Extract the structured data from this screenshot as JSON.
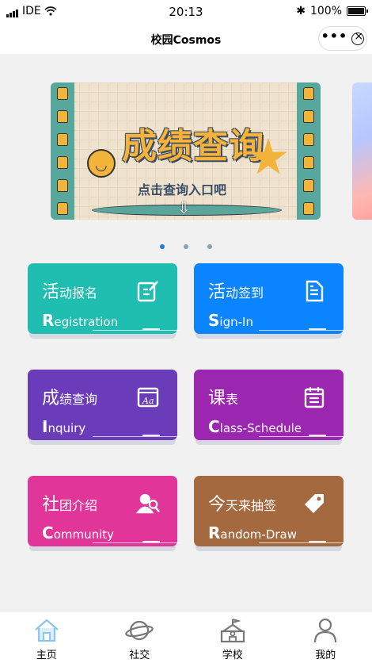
{
  "status": {
    "carrier": "IDE",
    "time": "20:13",
    "battery": "100%"
  },
  "navbar": {
    "title": "校园Cosmos",
    "more_label": "•••"
  },
  "banner": {
    "title": "成绩查询",
    "subtitle": "点击查询入口吧"
  },
  "cards": [
    {
      "title_first": "活",
      "title_rest": "动报名",
      "sub_first": "R",
      "sub_rest": "egistration",
      "color": "#20bdb1",
      "icon": "edit-icon"
    },
    {
      "title_first": "活",
      "title_rest": "动签到",
      "sub_first": "S",
      "sub_rest": "ign-In",
      "color": "#0a84ff",
      "icon": "document-icon"
    },
    {
      "title_first": "成",
      "title_rest": "绩查询",
      "sub_first": "I",
      "sub_rest": "nquiry",
      "color": "#6a3cba",
      "icon": "font-icon"
    },
    {
      "title_first": "课",
      "title_rest": "表",
      "sub_first": "C",
      "sub_rest": "lass-Schedule",
      "color": "#9b27b0",
      "icon": "calendar-icon"
    },
    {
      "title_first": "社",
      "title_rest": "团介绍",
      "sub_first": "C",
      "sub_rest": "ommunity",
      "color": "#e2359a",
      "icon": "user-search-icon"
    },
    {
      "title_first": "今",
      "title_rest": "天来抽签",
      "sub_first": "R",
      "sub_rest": "andom-Draw",
      "color": "#a56940",
      "icon": "tag-icon"
    }
  ],
  "tabs": [
    {
      "label": "主页",
      "icon": "home-icon",
      "active": true
    },
    {
      "label": "社交",
      "icon": "planet-icon",
      "active": false
    },
    {
      "label": "学校",
      "icon": "school-icon",
      "active": false
    },
    {
      "label": "我的",
      "icon": "person-icon",
      "active": false
    }
  ]
}
